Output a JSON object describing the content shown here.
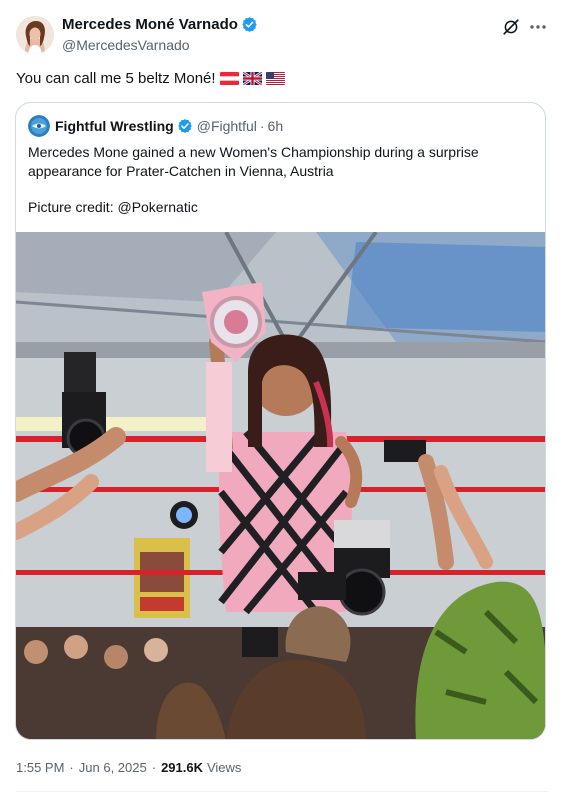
{
  "author": {
    "display_name": "Mercedes Moné Varnado",
    "handle": "@MercedesVarnado"
  },
  "tweet": {
    "text": "You can call me 5 beltz Moné!",
    "flags": [
      "austria-flag",
      "uk-flag",
      "us-flag"
    ]
  },
  "quote": {
    "display_name": "Fightful Wrestling",
    "handle": "@Fightful",
    "separator": "·",
    "time": "6h",
    "text": "Mercedes Mone gained a new Women's Championship during a surprise appearance for Prater-Catchen in Vienna, Austria",
    "credit": "Picture credit: @Pokernatic"
  },
  "meta": {
    "time": "1:55 PM",
    "date": "Jun 6, 2025",
    "separator": "·",
    "views_count": "291.6K",
    "views_label": "Views"
  },
  "colors": {
    "verified_blue": "#1d9bf0",
    "text_primary": "#0f1419",
    "text_secondary": "#536471",
    "border": "#cfd9de",
    "ring_rope": "#d8212b",
    "belt_pink": "#f2b3c4"
  },
  "icons": [
    "verified-icon",
    "grok-icon",
    "more-icon"
  ]
}
